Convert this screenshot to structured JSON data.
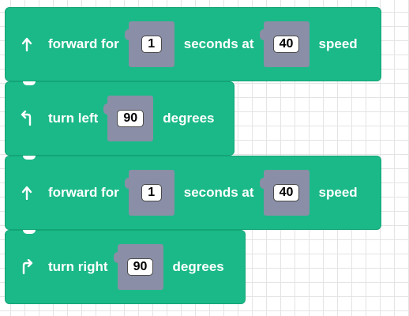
{
  "blocks": [
    {
      "icon": "arrow-up-icon",
      "label_before": "forward for",
      "value1": "1",
      "label_middle": "seconds at",
      "value2": "40",
      "label_after": "speed"
    },
    {
      "icon": "turn-left-icon",
      "label_before": "turn left",
      "value1": "90",
      "label_after": "degrees"
    },
    {
      "icon": "arrow-up-icon",
      "label_before": "forward for",
      "value1": "1",
      "label_middle": "seconds at",
      "value2": "40",
      "label_after": "speed"
    },
    {
      "icon": "turn-right-icon",
      "label_before": "turn right",
      "value1": "90",
      "label_after": "degrees"
    }
  ],
  "colors": {
    "block": "#1bb988",
    "slot": "#8a8ea6",
    "grid": "#e4e4e4"
  }
}
